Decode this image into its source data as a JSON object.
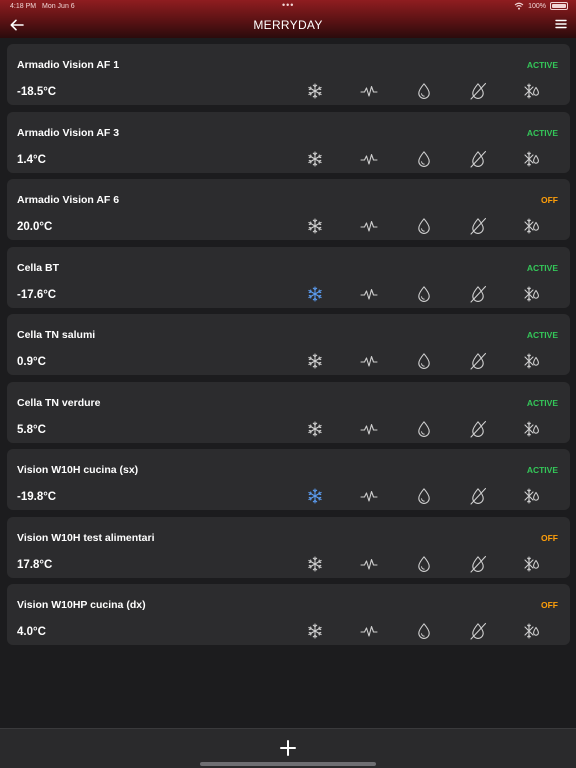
{
  "status_bar": {
    "time": "4:18 PM",
    "date": "Mon Jun 6",
    "battery": "100%"
  },
  "header": {
    "title": "MERRYDAY",
    "back_icon": "arrow-left-icon",
    "menu_icon": "hamburger-menu-icon"
  },
  "colors": {
    "active": "#34c759",
    "off": "#ff9f0a",
    "icon_idle": "#cfcfcf",
    "icon_highlight": "#5b9cf0"
  },
  "devices": [
    {
      "name": "Armadio Vision AF 1",
      "temperature": "-18.5°C",
      "status": "ACTIVE",
      "snow_highlight": false
    },
    {
      "name": "Armadio Vision AF 3",
      "temperature": "1.4°C",
      "status": "ACTIVE",
      "snow_highlight": false
    },
    {
      "name": "Armadio Vision AF 6",
      "temperature": "20.0°C",
      "status": "OFF",
      "snow_highlight": false
    },
    {
      "name": "Cella BT",
      "temperature": "-17.6°C",
      "status": "ACTIVE",
      "snow_highlight": true
    },
    {
      "name": "Cella TN salumi",
      "temperature": "0.9°C",
      "status": "ACTIVE",
      "snow_highlight": false
    },
    {
      "name": "Cella TN verdure",
      "temperature": "5.8°C",
      "status": "ACTIVE",
      "snow_highlight": false
    },
    {
      "name": "Vision W10H cucina (sx)",
      "temperature": "-19.8°C",
      "status": "ACTIVE",
      "snow_highlight": true
    },
    {
      "name": "Vision W10H test alimentari",
      "temperature": "17.8°C",
      "status": "OFF",
      "snow_highlight": false
    },
    {
      "name": "Vision W10HP cucina (dx)",
      "temperature": "4.0°C",
      "status": "OFF",
      "snow_highlight": false
    }
  ],
  "device_icons": [
    "snowflake-icon",
    "pulse-icon",
    "droplet-icon",
    "droplet-off-icon",
    "defrost-icon"
  ],
  "bottom_bar": {
    "add_icon": "plus-icon"
  }
}
